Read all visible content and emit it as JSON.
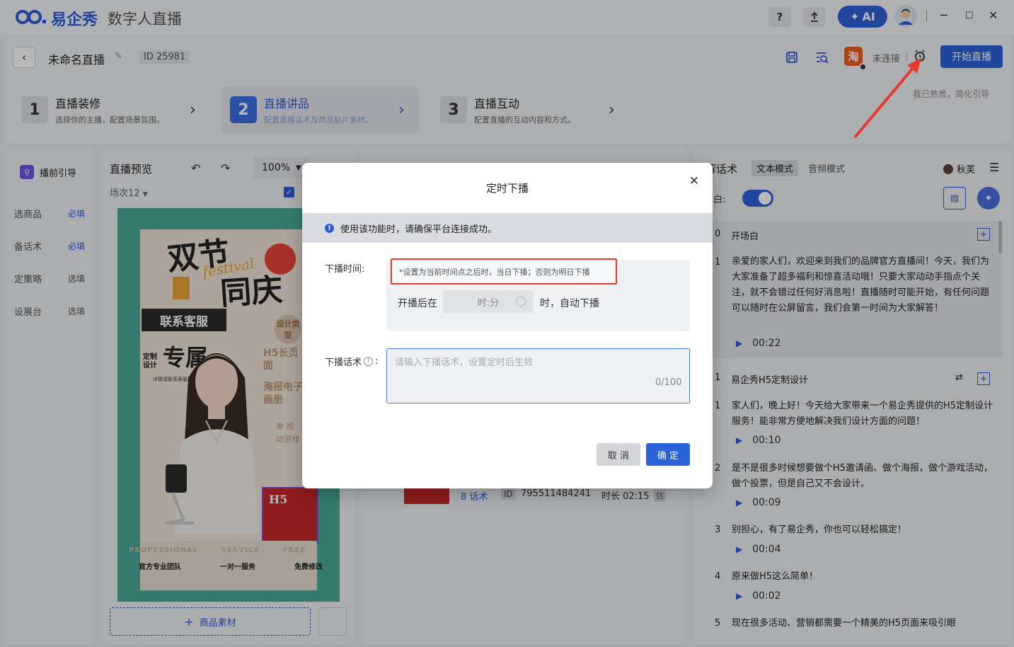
{
  "titlebar": {
    "brand": "易企秀",
    "app_name": "数字人直播",
    "help_icon": "?",
    "ai_label": "AI",
    "minimize": "─",
    "maximize": "☐",
    "close": "✕"
  },
  "header": {
    "project_title": "未命名直播",
    "id_text": "ID 25981",
    "taobao_label": "淘",
    "status": "未连接",
    "start_button": "开始直播",
    "familiar_link": "我已熟悉，简化引导",
    "steps": [
      {
        "num": "1",
        "title": "直播装修",
        "desc": "选择你的主播，配置场景氛围。"
      },
      {
        "num": "2",
        "title": "直播讲品",
        "desc": "配置直播话术及商品贴片素材。"
      },
      {
        "num": "3",
        "title": "直播互动",
        "desc": "配置直播的互动内容和方式。"
      }
    ]
  },
  "sidebar": {
    "title": "播前引导",
    "items": [
      {
        "label": "选商品",
        "tag": "必填"
      },
      {
        "label": "备话术",
        "tag": "必填"
      },
      {
        "label": "定策略",
        "tag": "选填"
      },
      {
        "label": "设展台",
        "tag": "选填"
      }
    ]
  },
  "preview": {
    "title": "直播预览",
    "zoom": "100%",
    "session": "场次12",
    "poster": {
      "headline_1": "双节",
      "headline_2": "同庆",
      "script_overlay": "festival",
      "badge": "联系客服",
      "exclusive_small": "定制设计",
      "exclusive_big": "专属",
      "contact_note": "详情请联系客服咨询",
      "tags": [
        "设计类型",
        "H5长页面",
        "海报电子画册",
        "单 视",
        "动游戏"
      ],
      "h5_card": "H5",
      "footer_words": [
        "PROFESSIONAL",
        "SERVICE",
        "FREE"
      ],
      "footer_items": [
        "官方专业团队",
        "一对一服务",
        "免费修改"
      ]
    },
    "material_button": "商品素材"
  },
  "middle": {
    "script_count": "8 话术",
    "id_label": "ID",
    "id_value": "795511484241",
    "duration": "时长 02:15",
    "est": "估"
  },
  "right": {
    "title": "讲解话术",
    "mode_text": "文本模式",
    "mode_audio": "音频模式",
    "voice": "秋芙",
    "opening_toggle_label": "开场白:",
    "sections": [
      {
        "index": "0",
        "title": "开场白",
        "lines": [
          {
            "n": "1",
            "text": "亲爱的家人们，欢迎来到我们的品牌官方直播间！今天，我们为大家准备了超多福利和惊喜活动哦！只要大家动动手指点个关注，就不会错过任何好消息啦！直播随时可能开始，有任何问题可以随时在公屏留言，我们会第一时间为大家解答！",
            "dur": "00:22"
          }
        ]
      },
      {
        "index": "1",
        "title": "易企秀H5定制设计",
        "lines": [
          {
            "n": "1",
            "text": "家人们，晚上好！今天给大家带来一个易企秀提供的H5定制设计服务！能非常方便地解决我们设计方面的问题！",
            "dur": "00:10"
          },
          {
            "n": "2",
            "text": "是不是很多时候想要做个H5邀请函、做个海报，做个游戏活动，做个投票，但是自己又不会设计。",
            "dur": "00:09"
          },
          {
            "n": "3",
            "text": "别担心，有了易企秀，你也可以轻松搞定！",
            "dur": "00:04"
          },
          {
            "n": "4",
            "text": "原来做H5这么简单！",
            "dur": "00:02"
          },
          {
            "n": "5",
            "text": "现在很多活动、营销都需要一个精美的H5页面来吸引眼",
            "dur": ""
          }
        ]
      }
    ]
  },
  "modal": {
    "title": "定时下播",
    "notice": "使用该功能时，请确保平台连接成功。",
    "time_label": "下播时间:",
    "hint": "*设置为当前时间点之后时，当日下播；否则为明日下播",
    "after_prefix": "开播后在",
    "time_placeholder": "时:分",
    "after_suffix": "时，自动下播",
    "script_label": "下播话术",
    "script_label_colon": ":",
    "script_placeholder": "请输入下播话术，设置定时后生效",
    "counter": "0/100",
    "cancel": "取 消",
    "confirm": "确 定"
  },
  "colors": {
    "primary": "#2962d9",
    "annotation_red": "#e53a2e",
    "taobao": "#f25b1e"
  }
}
